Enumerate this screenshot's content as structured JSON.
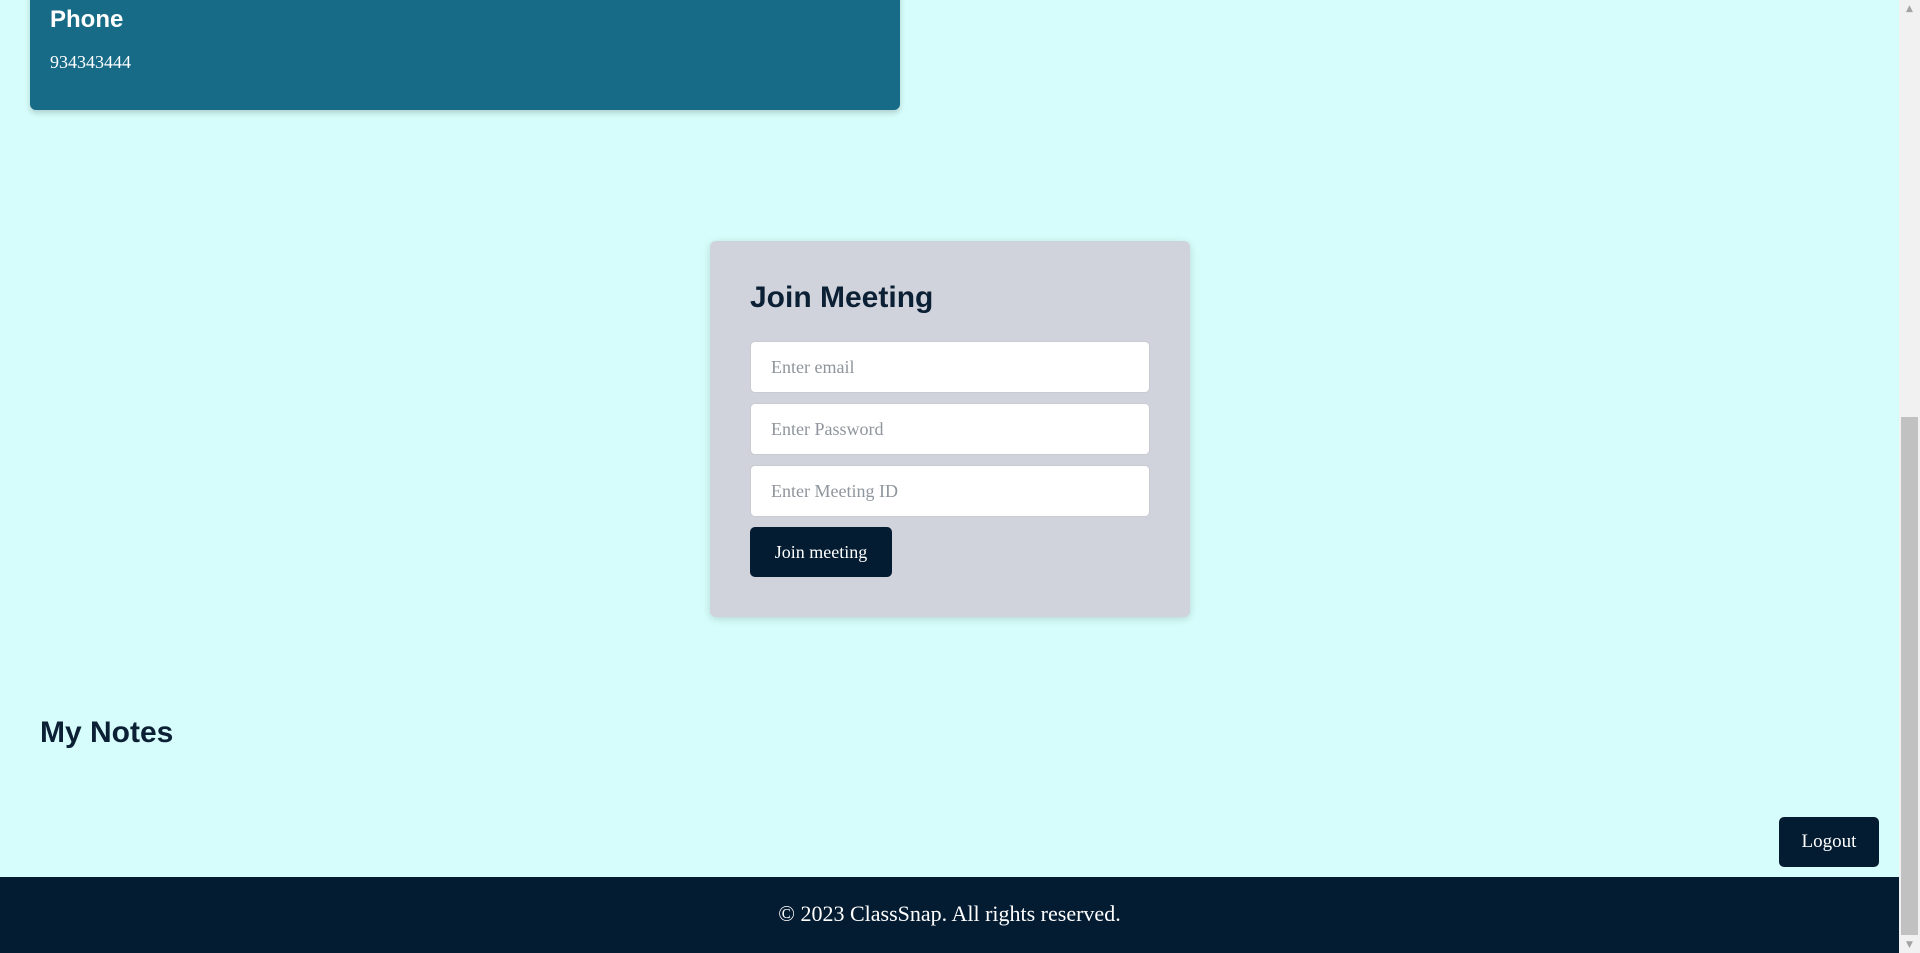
{
  "contact_card": {
    "title": "Phone",
    "value": "934343444"
  },
  "join_meeting": {
    "title": "Join Meeting",
    "email_placeholder": "Enter email",
    "password_placeholder": "Enter Password",
    "meeting_id_placeholder": "Enter Meeting ID",
    "submit_label": "Join meeting"
  },
  "notes": {
    "title": "My Notes"
  },
  "logout_label": "Logout",
  "footer": {
    "text": "© 2023 ClassSnap. All rights reserved."
  },
  "scrollbar": {
    "up_icon": "▲",
    "down_icon": "▼"
  },
  "colors": {
    "page_background": "#d6fdfb",
    "card_accent": "#176b87",
    "dark_navy": "#041c32",
    "form_panel": "#d0d3db"
  }
}
